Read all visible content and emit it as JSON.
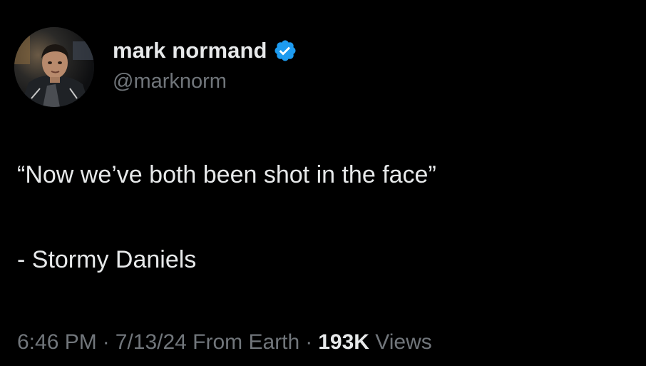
{
  "user": {
    "display_name": "mark normand",
    "handle": "@marknorm",
    "verified": true,
    "verified_color": "#1d9bf0"
  },
  "tweet": {
    "lines": [
      "“Now we’ve both been shot in the face”",
      "- Stormy Daniels"
    ]
  },
  "meta": {
    "time": "6:46 PM",
    "separator": "·",
    "date": "7/13/24",
    "source": "From Earth",
    "views_count": "193K",
    "views_label": "Views"
  },
  "icons": {
    "avatar": "profile-photo",
    "verified": "verified-badge-icon"
  }
}
